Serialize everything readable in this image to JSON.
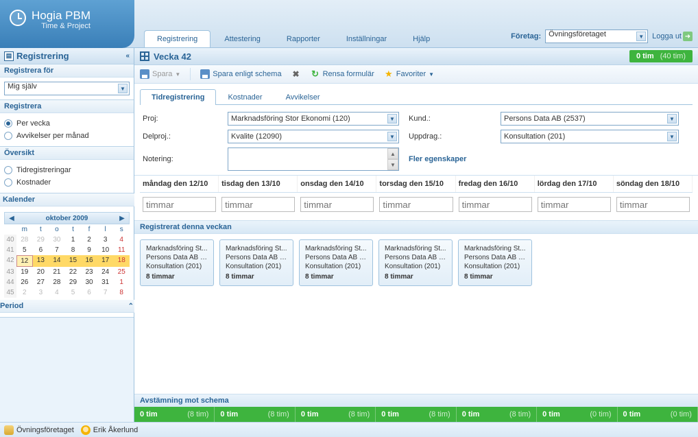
{
  "logo": {
    "title": "Hogia PBM",
    "subtitle": "Time & Project"
  },
  "tabs": [
    "Registrering",
    "Attestering",
    "Rapporter",
    "Inställningar",
    "Hjälp"
  ],
  "header": {
    "company_label": "Företag:",
    "company_value": "Övningsföretaget",
    "logout": "Logga ut"
  },
  "sidebar": {
    "title": "Registrering",
    "register_for": {
      "title": "Registrera för",
      "value": "Mig själv"
    },
    "register": {
      "title": "Registrera",
      "options": [
        "Per vecka",
        "Avvikelser per månad"
      ],
      "selected": 0
    },
    "overview": {
      "title": "Översikt",
      "options": [
        "Tidregistreringar",
        "Kostnader"
      ]
    },
    "calendar": {
      "title": "Kalender",
      "month": "oktober 2009",
      "dow": [
        "m",
        "t",
        "o",
        "t",
        "f",
        "l",
        "s"
      ],
      "weeks": [
        {
          "wk": 40,
          "days": [
            {
              "d": 28,
              "o": true
            },
            {
              "d": 29,
              "o": true
            },
            {
              "d": 30,
              "o": true
            },
            {
              "d": 1
            },
            {
              "d": 2
            },
            {
              "d": 3
            },
            {
              "d": 4,
              "r": true
            }
          ]
        },
        {
          "wk": 41,
          "days": [
            {
              "d": 5
            },
            {
              "d": 6
            },
            {
              "d": 7
            },
            {
              "d": 8
            },
            {
              "d": 9
            },
            {
              "d": 10
            },
            {
              "d": 11,
              "r": true
            }
          ]
        },
        {
          "wk": 42,
          "days": [
            {
              "d": 12,
              "t": true
            },
            {
              "d": 13,
              "h": true
            },
            {
              "d": 14,
              "h": true
            },
            {
              "d": 15,
              "h": true
            },
            {
              "d": 16,
              "h": true
            },
            {
              "d": 17,
              "h": true
            },
            {
              "d": 18,
              "h": true,
              "r": true
            }
          ]
        },
        {
          "wk": 43,
          "days": [
            {
              "d": 19
            },
            {
              "d": 20
            },
            {
              "d": 21
            },
            {
              "d": 22
            },
            {
              "d": 23
            },
            {
              "d": 24
            },
            {
              "d": 25,
              "r": true
            }
          ]
        },
        {
          "wk": 44,
          "days": [
            {
              "d": 26
            },
            {
              "d": 27
            },
            {
              "d": 28
            },
            {
              "d": 29
            },
            {
              "d": 30
            },
            {
              "d": 31
            },
            {
              "d": 1,
              "o": true,
              "r": true
            }
          ]
        },
        {
          "wk": 45,
          "days": [
            {
              "d": 2,
              "o": true
            },
            {
              "d": 3,
              "o": true
            },
            {
              "d": 4,
              "o": true
            },
            {
              "d": 5,
              "o": true
            },
            {
              "d": 6,
              "o": true
            },
            {
              "d": 7,
              "o": true
            },
            {
              "d": 8,
              "o": true,
              "r": true
            }
          ]
        }
      ]
    },
    "period": {
      "title": "Period"
    }
  },
  "content": {
    "week_title": "Vecka 42",
    "summary": {
      "main": "0 tim",
      "paren": "(40 tim)"
    },
    "toolbar": {
      "save": "Spara",
      "save_schema": "Spara enligt schema",
      "clear": "Rensa formulär",
      "favorites": "Favoriter"
    },
    "subtabs": [
      "Tidregistrering",
      "Kostnader",
      "Avvikelser"
    ],
    "form": {
      "proj_l": "Proj:",
      "proj_v": "Marknadsföring Stor Ekonomi (120)",
      "kund_l": "Kund.:",
      "kund_v": "Persons Data AB (2537)",
      "delproj_l": "Delproj.:",
      "delproj_v": "Kvalite (12090)",
      "uppdrag_l": "Uppdrag.:",
      "uppdrag_v": "Konsultation (201)",
      "notering_l": "Notering:",
      "more": "Fler egenskaper"
    },
    "days": [
      "måndag den 12/10",
      "tisdag den 13/10",
      "onsdag den 14/10",
      "torsdag den 15/10",
      "fredag den 16/10",
      "lördag den 17/10",
      "söndag den 18/10"
    ],
    "hours_placeholder": "timmar",
    "registered_title": "Registrerat denna veckan",
    "cards": [
      {
        "l1": "Marknadsföring St...",
        "l2": "Persons Data AB (2...",
        "l3": "Konsultation (201)",
        "l4": "8 timmar"
      },
      {
        "l1": "Marknadsföring St...",
        "l2": "Persons Data AB (2...",
        "l3": "Konsultation (201)",
        "l4": "8 timmar"
      },
      {
        "l1": "Marknadsföring St...",
        "l2": "Persons Data AB (2...",
        "l3": "Konsultation (201)",
        "l4": "8 timmar"
      },
      {
        "l1": "Marknadsföring St...",
        "l2": "Persons Data AB (2...",
        "l3": "Konsultation (201)",
        "l4": "8 timmar"
      },
      {
        "l1": "Marknadsföring St...",
        "l2": "Persons Data AB (2...",
        "l3": "Konsultation (201)",
        "l4": "8 timmar"
      }
    ],
    "recon_title": "Avstämning mot schema",
    "recon": [
      {
        "m": "0 tim",
        "p": "(8 tim)"
      },
      {
        "m": "0 tim",
        "p": "(8 tim)"
      },
      {
        "m": "0 tim",
        "p": "(8 tim)"
      },
      {
        "m": "0 tim",
        "p": "(8 tim)"
      },
      {
        "m": "0 tim",
        "p": "(8 tim)"
      },
      {
        "m": "0 tim",
        "p": "(0 tim)"
      },
      {
        "m": "0 tim",
        "p": "(0 tim)"
      }
    ]
  },
  "status": {
    "company": "Övningsföretaget",
    "user": "Erik Åkerlund"
  }
}
